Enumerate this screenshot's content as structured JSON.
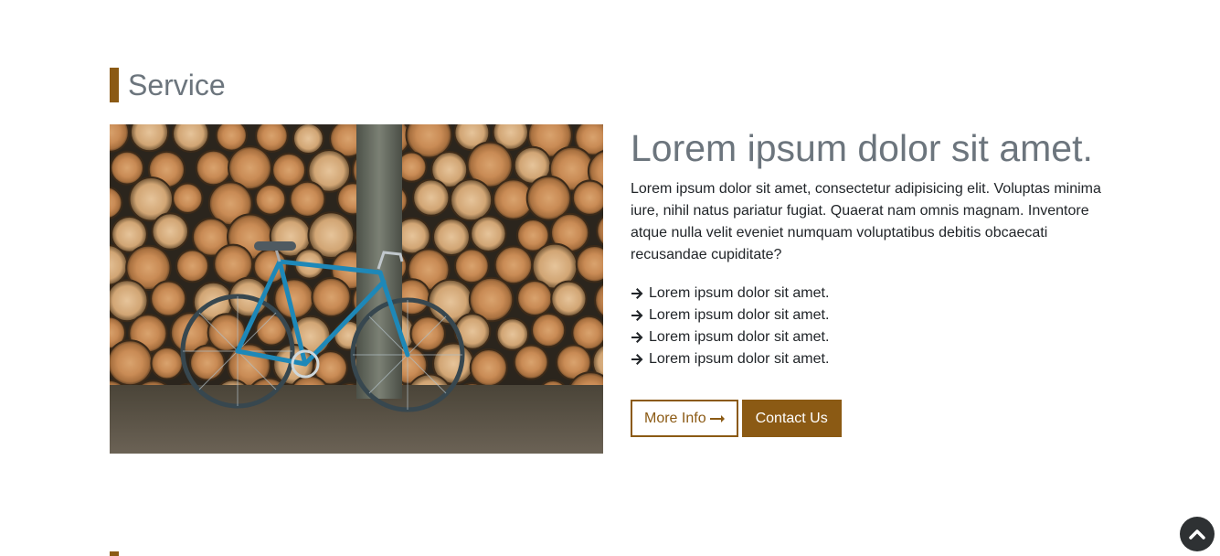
{
  "section": {
    "title": "Service"
  },
  "service": {
    "heading": "Lorem ipsum dolor sit amet.",
    "description": "Lorem ipsum dolor sit amet, consectetur adipisicing elit. Voluptas minima iure, nihil natus pariatur fugiat. Quaerat nam omnis magnam. Inventore atque nulla velit eveniet numquam voluptatibus debitis obcaecati recusandae cupiditate?",
    "features": [
      "Lorem ipsum dolor sit amet.",
      "Lorem ipsum dolor sit amet.",
      "Lorem ipsum dolor sit amet.",
      "Lorem ipsum dolor sit amet."
    ],
    "more_info_label": "More Info",
    "contact_label": "Contact Us",
    "image_icon": "bicycle-against-log-pile-photo"
  },
  "colors": {
    "accent": "#8b5a14",
    "heading": "#6c757d",
    "text": "#212529",
    "back_to_top_bg": "#2e3133"
  },
  "icons": {
    "feature_bullet": "arrow-right-icon",
    "more_info": "long-arrow-right-icon",
    "back_to_top": "chevron-up-icon"
  }
}
